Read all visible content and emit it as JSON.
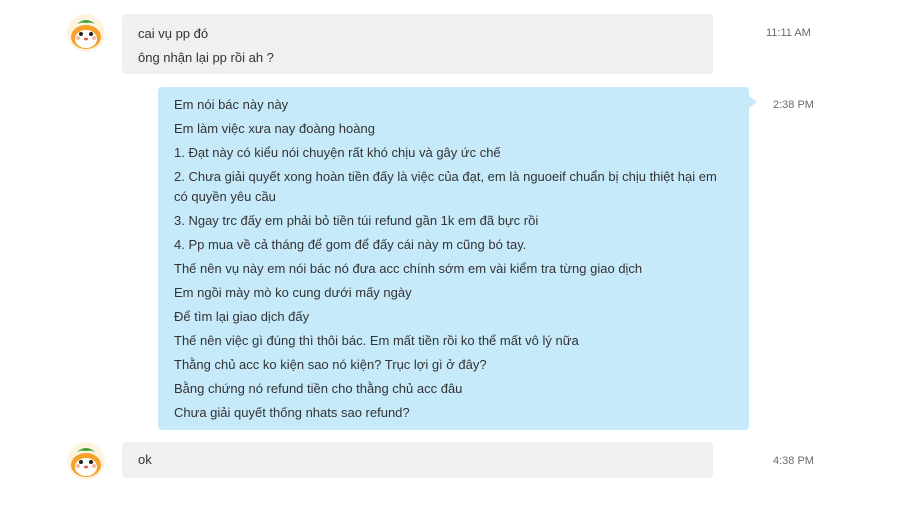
{
  "conversation": {
    "messages": [
      {
        "direction": "incoming",
        "sender_avatar": "hamster-avatar",
        "lines": [
          "cai vụ pp đó",
          "ông nhận lại pp rồi ah ?"
        ],
        "time": "11:11 AM"
      },
      {
        "direction": "outgoing",
        "lines": [
          "Em nói bác này này",
          "Em làm việc xưa nay đoàng hoàng",
          "1. Đạt này có kiểu nói chuyện rất khó chịu và gây ức chế",
          "2. Chưa giải quyết xong hoàn tiền đấy là việc của đạt, em là nguoeif chuẩn bị chịu thiệt hại em có quyền yêu cầu",
          "3. Ngay trc đấy em phải bỏ tiền túi refund gần 1k em đã bực rồi",
          "4. Pp mua về cả tháng để gom để đấy cái này m cũng bó tay.",
          "Thế nên vụ này em nói bác nó đưa acc chính sớm em vài kiểm tra từng giao dịch",
          "Em ngồi mày mò ko cung dưới mấy ngày",
          "Để tìm lại giao dịch đấy",
          "Thế nên việc gì đúng thì thôi bác. Em mất tiền rồi ko thể mất vô lý nữa",
          "Thằng chủ acc ko kiện sao nó kiện? Trục lợi gì ở đây?",
          "Bằng chứng nó refund tiền cho thằng chủ acc đâu",
          "Chưa giải quyết thống nhats sao refund?"
        ],
        "time": "2:38 PM"
      },
      {
        "direction": "incoming",
        "sender_avatar": "hamster-avatar",
        "lines": [
          "ok"
        ],
        "time": "4:38 PM"
      }
    ]
  },
  "colors": {
    "incoming_bubble": "#eef0f2",
    "outgoing_bubble": "#c7eafb",
    "timestamp": "#666a70",
    "text": "#333333"
  }
}
